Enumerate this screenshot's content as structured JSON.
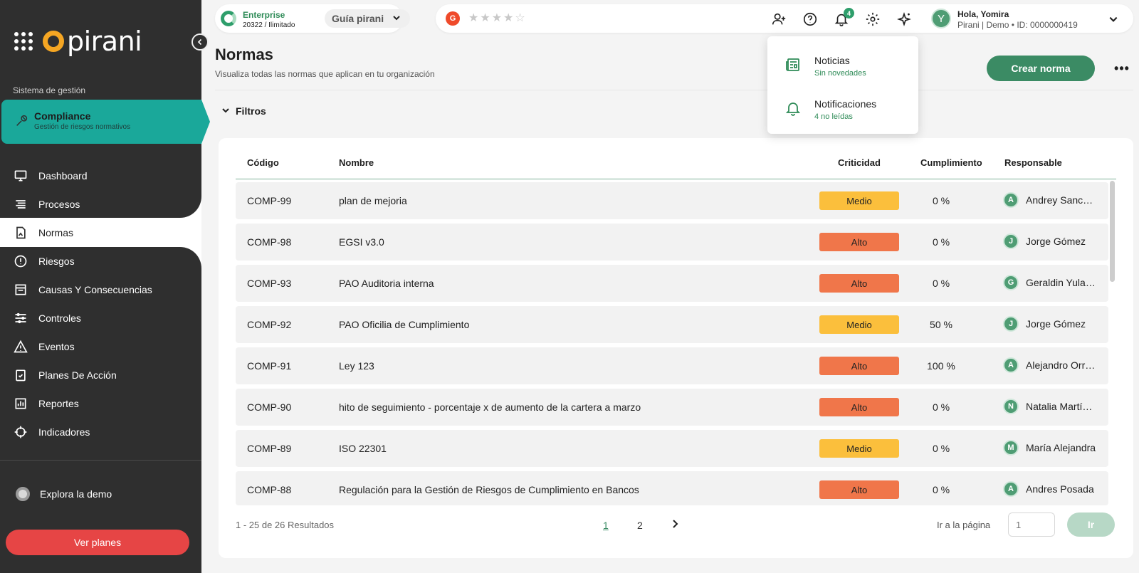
{
  "sidebar": {
    "brand": "pirani",
    "section_label": "Sistema de gestión",
    "active_module": {
      "title": "Compliance",
      "subtitle": "Gestión de riesgos normativos"
    },
    "items": [
      {
        "label": "Dashboard",
        "icon": "monitor-icon"
      },
      {
        "label": "Procesos",
        "icon": "list-icon"
      },
      {
        "label": "Normas",
        "icon": "document-icon",
        "selected": true
      },
      {
        "label": "Riesgos",
        "icon": "alert-circle-icon"
      },
      {
        "label": "Causas Y Consecuencias",
        "icon": "archive-icon"
      },
      {
        "label": "Controles",
        "icon": "sliders-icon"
      },
      {
        "label": "Eventos",
        "icon": "warning-triangle-icon"
      },
      {
        "label": "Planes De Acción",
        "icon": "checklist-icon"
      },
      {
        "label": "Reportes",
        "icon": "bar-chart-icon"
      },
      {
        "label": "Indicadores",
        "icon": "crosshair-icon"
      }
    ],
    "explore_label": "Explora la demo",
    "plans_button": "Ver planes"
  },
  "topbar": {
    "plan_name": "Enterprise",
    "plan_detail": "20322 / Ilimitado",
    "guide_label": "Guía pirani",
    "g2_label": "G",
    "stars": "★★★★☆",
    "notification_count": "4",
    "greeting": "Hola, Yomira",
    "org_line": "Pirani | Demo • ID: 0000000419",
    "avatar_letter": "Y"
  },
  "page": {
    "title": "Normas",
    "subtitle": "Visualiza todas las normas que aplican en tu organización",
    "create_button": "Crear norma",
    "filters_label": "Filtros"
  },
  "table": {
    "headers": {
      "code": "Código",
      "name": "Nombre",
      "criticality": "Criticidad",
      "compliance": "Cumplimiento",
      "owner": "Responsable"
    },
    "rows": [
      {
        "code": "COMP-99",
        "name": "plan de mejoria",
        "criticality": "Medio",
        "compliance": "0 %",
        "owner_initial": "A",
        "owner": "Andrey Sanchez"
      },
      {
        "code": "COMP-98",
        "name": "EGSI v3.0",
        "criticality": "Alto",
        "compliance": "0 %",
        "owner_initial": "J",
        "owner": "Jorge Gómez"
      },
      {
        "code": "COMP-93",
        "name": "PAO Auditoria interna",
        "criticality": "Alto",
        "compliance": "0 %",
        "owner_initial": "G",
        "owner": "Geraldin Yulaina"
      },
      {
        "code": "COMP-92",
        "name": "PAO Oficilia de Cumplimiento",
        "criticality": "Medio",
        "compliance": "50 %",
        "owner_initial": "J",
        "owner": "Jorge Gómez"
      },
      {
        "code": "COMP-91",
        "name": "Ley 123",
        "criticality": "Alto",
        "compliance": "100 %",
        "owner_initial": "A",
        "owner": "Alejandro Orrego"
      },
      {
        "code": "COMP-90",
        "name": "hito de seguimiento - porcentaje x de aumento de la cartera a marzo",
        "criticality": "Alto",
        "compliance": "0 %",
        "owner_initial": "N",
        "owner": "Natalia Martínez"
      },
      {
        "code": "COMP-89",
        "name": "ISO 22301",
        "criticality": "Medio",
        "compliance": "0 %",
        "owner_initial": "M",
        "owner": "María Alejandra"
      },
      {
        "code": "COMP-88",
        "name": "Regulación para la Gestión de Riesgos de Cumplimiento en Bancos",
        "criticality": "Alto",
        "compliance": "0 %",
        "owner_initial": "A",
        "owner": "Andres Posada"
      }
    ],
    "colors": {
      "Medio": "#fbbf3c",
      "Alto": "#f0764a"
    }
  },
  "pagination": {
    "results": "1 - 25 de 26 Resultados",
    "pages": [
      "1",
      "2"
    ],
    "current_page": "1",
    "goto_label": "Ir a la página",
    "goto_placeholder": "1",
    "goto_button": "Ir"
  },
  "popover": {
    "items": [
      {
        "title": "Noticias",
        "subtitle": "Sin novedades",
        "icon": "newspaper-icon"
      },
      {
        "title": "Notificaciones",
        "subtitle": "4 no leídas",
        "icon": "bell-icon"
      }
    ]
  },
  "colors": {
    "brand_green": "#3b8b64",
    "sidebar_dark": "#2f2f2f",
    "active_teal": "#1aa89a",
    "plans_red": "#e64545"
  }
}
